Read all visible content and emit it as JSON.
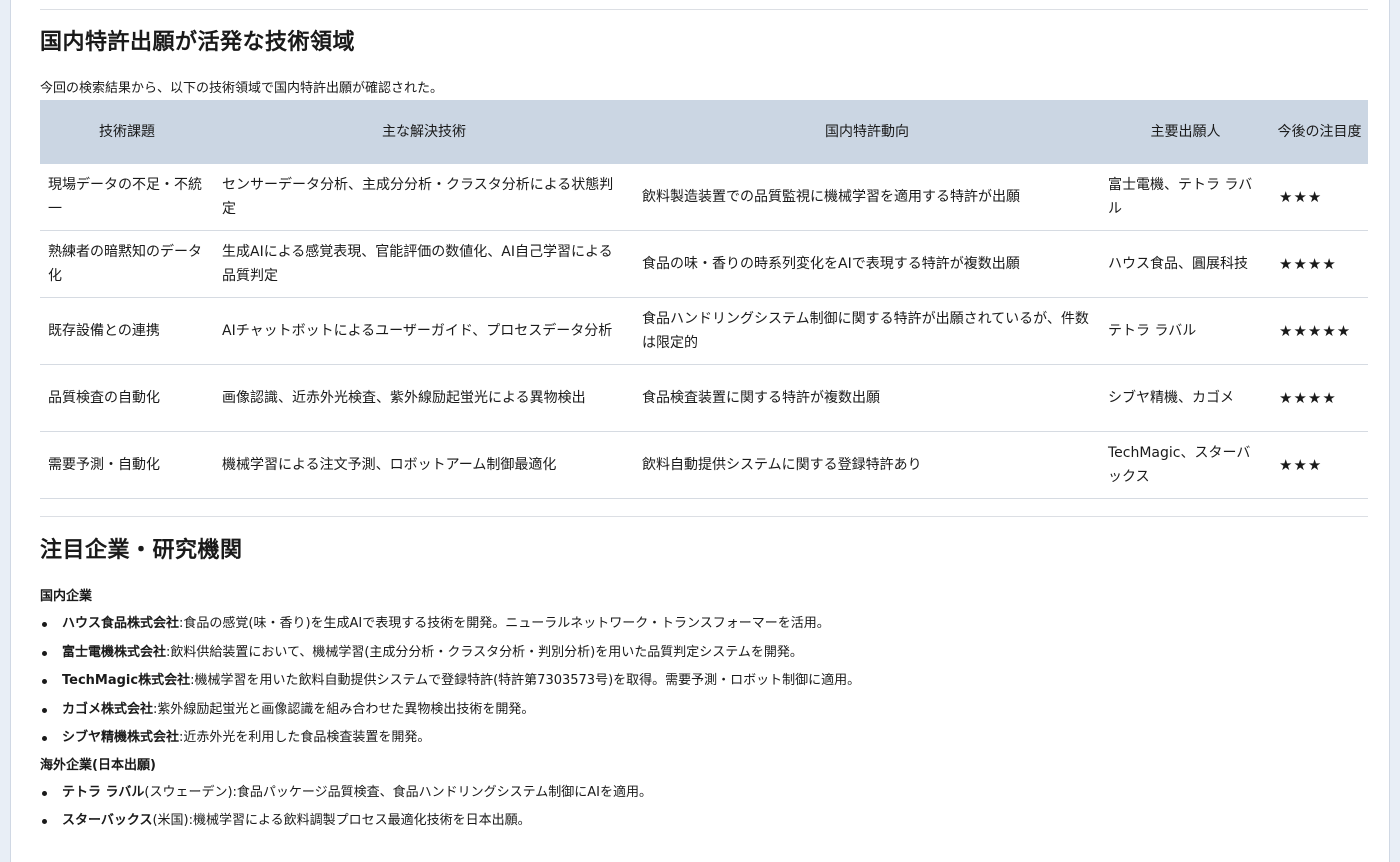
{
  "section1": {
    "title": "国内特許出願が活発な技術領域",
    "intro": "今回の検索結果から、以下の技術領域で国内特許出願が確認された。",
    "headers": [
      "技術課題",
      "主な解決技術",
      "国内特許動向",
      "主要出願人",
      "今後の注目度"
    ],
    "rows": [
      [
        "現場データの不足・不統一",
        "センサーデータ分析、主成分分析・クラスタ分析による状態判定",
        "飲料製造装置での品質監視に機械学習を適用する特許が出願",
        "富士電機、テトラ ラバル",
        "★★★"
      ],
      [
        "熟練者の暗黙知のデータ化",
        "生成AIによる感覚表現、官能評価の数値化、AI自己学習による品質判定",
        "食品の味・香りの時系列変化をAIで表現する特許が複数出願",
        "ハウス食品、圓展科技",
        "★★★★"
      ],
      [
        "既存設備との連携",
        "AIチャットボットによるユーザーガイド、プロセスデータ分析",
        "食品ハンドリングシステム制御に関する特許が出願されているが、件数は限定的",
        "テトラ ラバル",
        "★★★★★"
      ],
      [
        "品質検査の自動化",
        "画像認識、近赤外光検査、紫外線励起蛍光による異物検出",
        "食品検査装置に関する特許が複数出願",
        "シブヤ精機、カゴメ",
        "★★★★"
      ],
      [
        "需要予測・自動化",
        "機械学習による注文予測、ロボットアーム制御最適化",
        "飲料自動提供システムに関する登録特許あり",
        "TechMagic、スターバックス",
        "★★★"
      ]
    ]
  },
  "section2": {
    "title": "注目企業・研究機関",
    "domestic_heading": "国内企業",
    "domestic": [
      {
        "name": "ハウス食品株式会社",
        "desc": ":食品の感覚(味・香り)を生成AIで表現する技術を開発。ニューラルネットワーク・トランスフォーマーを活用。"
      },
      {
        "name": "富士電機株式会社",
        "desc": ":飲料供給装置において、機械学習(主成分分析・クラスタ分析・判別分析)を用いた品質判定システムを開発。"
      },
      {
        "name": "TechMagic株式会社",
        "desc": ":機械学習を用いた飲料自動提供システムで登録特許(特許第7303573号)を取得。需要予測・ロボット制御に適用。"
      },
      {
        "name": "カゴメ株式会社",
        "desc": ":紫外線励起蛍光と画像認識を組み合わせた異物検出技術を開発。"
      },
      {
        "name": "シブヤ精機株式会社",
        "desc": ":近赤外光を利用した食品検査装置を開発。"
      }
    ],
    "overseas_heading": "海外企業(日本出願)",
    "overseas": [
      {
        "name": "テトラ ラバル",
        "desc": "(スウェーデン):食品パッケージ品質検査、食品ハンドリングシステム制御にAIを適用。"
      },
      {
        "name": "スターバックス",
        "desc": "(米国):機械学習による飲料調製プロセス最適化技術を日本出願。"
      }
    ]
  }
}
